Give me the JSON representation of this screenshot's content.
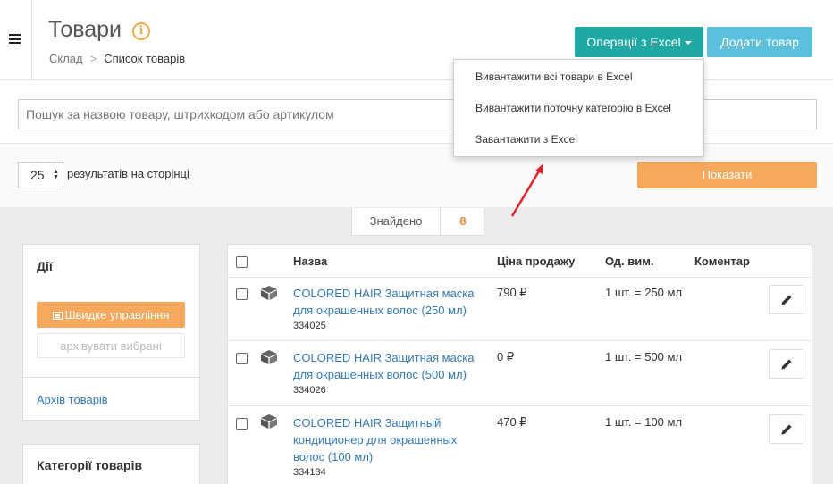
{
  "header": {
    "title": "Товари",
    "info_icon": "info-icon",
    "breadcrumb": {
      "root": "Склад",
      "separator": ">",
      "current": "Список товарів"
    },
    "excel_button": "Операції з Excel",
    "add_button": "Додати товар"
  },
  "excel_menu": {
    "items": [
      "Вивантажити всі товари в Excel",
      "Вивантажити поточну категорію в Excel",
      "Завантажити з Excel"
    ]
  },
  "search": {
    "placeholder": "Пошук за назвою товару, штрихкодом або артикулом",
    "value": ""
  },
  "filters": {
    "per_page": "25",
    "per_page_label": "результатів на сторінці",
    "show_button": "Показати"
  },
  "found": {
    "label": "Знайдено",
    "count": "8"
  },
  "sidebar": {
    "actions_title": "Дії",
    "quick_manage": "Швидке управління",
    "archive_selected": "архівувати вибрані",
    "archive_link": "Архів товарів",
    "categories_title": "Категорії товарів"
  },
  "table": {
    "columns": [
      "Назва",
      "Ціна продажу",
      "Од. вим.",
      "Коментар"
    ],
    "rows": [
      {
        "name": "COLORED HAIR Защитная маска для окрашенных волос (250 мл)",
        "sku": "334025",
        "price": "790 ₽",
        "unit": "1 шт. = 250 мл",
        "comment": ""
      },
      {
        "name": "COLORED HAIR Защитная маска для окрашенных волос (500 мл)",
        "sku": "334026",
        "price": "0 ₽",
        "unit": "1 шт. = 500 мл",
        "comment": ""
      },
      {
        "name": "COLORED HAIR Защитный кондиционер для окрашенных волос (100 мл)",
        "sku": "334134",
        "price": "470 ₽",
        "unit": "1 шт. = 100 мл",
        "comment": ""
      }
    ]
  },
  "colors": {
    "teal": "#1fa9a5",
    "light_blue": "#5bc0de",
    "orange": "#f6a95c",
    "link": "#337ab7",
    "annotation_arrow": "#e8202a"
  }
}
